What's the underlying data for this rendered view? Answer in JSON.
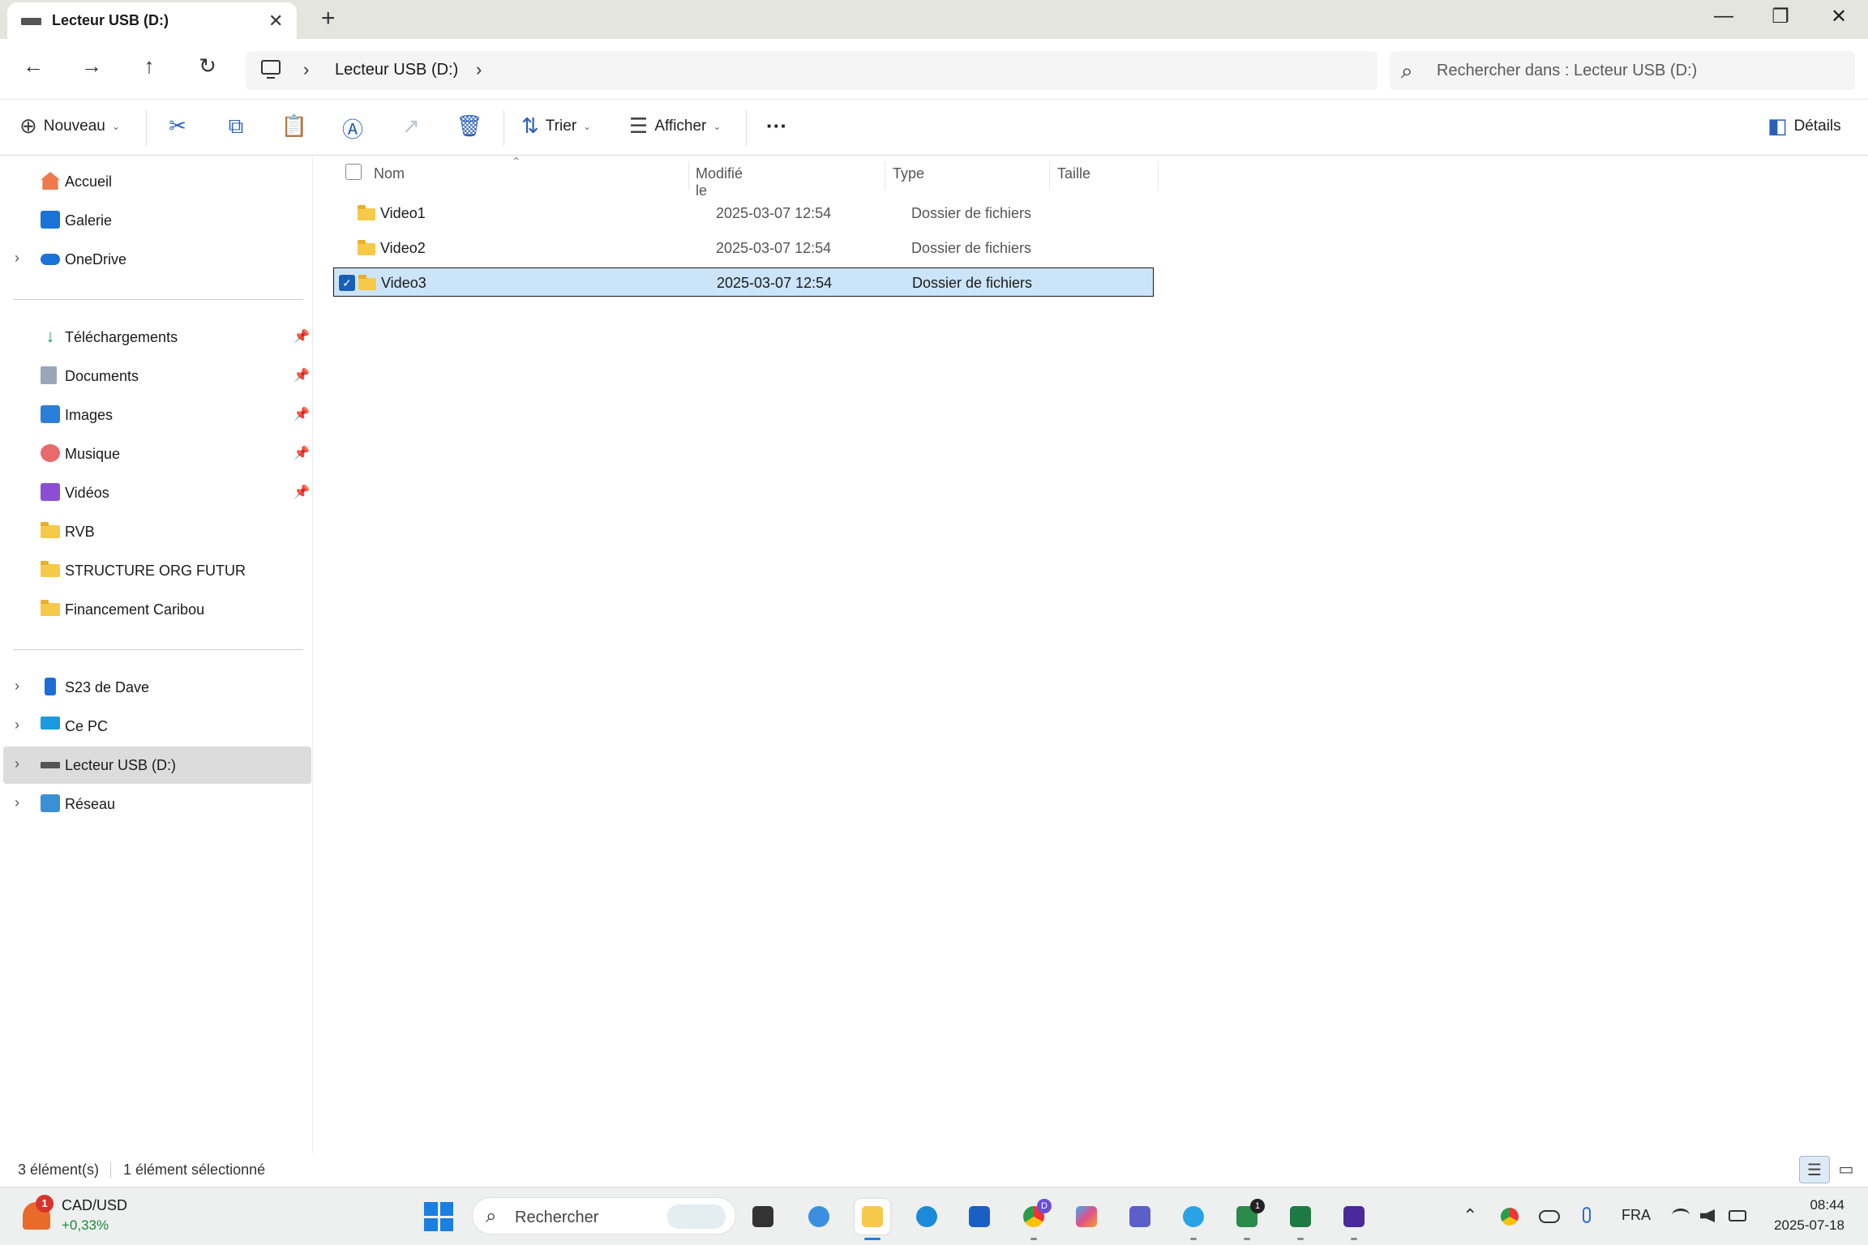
{
  "window": {
    "tab_title": "Lecteur USB (D:)",
    "close_tab_glyph": "✕",
    "new_tab_glyph": "+",
    "controls": {
      "minimize": "—",
      "maximize": "❐",
      "close": "✕"
    }
  },
  "nav": {
    "back_glyph": "←",
    "forward_glyph": "→",
    "up_glyph": "↑",
    "refresh_glyph": "↻",
    "breadcrumb_sep": "›",
    "breadcrumb_location": "Lecteur USB (D:)",
    "search_placeholder": "Rechercher dans : Lecteur USB (D:)",
    "search_glyph": "⌕"
  },
  "commands": {
    "new_label": "Nouveau",
    "new_glyph": "⊕",
    "cut_glyph": "✂",
    "copy_glyph": "⧉",
    "paste_glyph": "📋",
    "rename_glyph": "Ⓐ",
    "share_glyph": "↗",
    "delete_glyph": "🗑",
    "sort_label": "Trier",
    "sort_glyph": "⇅",
    "view_label": "Afficher",
    "view_glyph": "☰",
    "more_glyph": "···",
    "caret_glyph": "⌄",
    "details_label": "Détails",
    "details_glyph": "◧"
  },
  "sidebar": {
    "chevron_glyph": "›",
    "pin_glyph": "📌",
    "quick": [
      {
        "label": "Accueil",
        "icon": "home-icon"
      },
      {
        "label": "Galerie",
        "icon": "gallery-icon"
      },
      {
        "label": "OneDrive",
        "icon": "onedrive-icon",
        "expandable": true
      }
    ],
    "pinned": [
      {
        "label": "Téléchargements",
        "icon": "download-icon",
        "pinned": true
      },
      {
        "label": "Documents",
        "icon": "documents-icon",
        "pinned": true
      },
      {
        "label": "Images",
        "icon": "images-icon",
        "pinned": true
      },
      {
        "label": "Musique",
        "icon": "music-icon",
        "pinned": true
      },
      {
        "label": "Vidéos",
        "icon": "videos-icon",
        "pinned": true
      },
      {
        "label": "RVB",
        "icon": "folder-icon"
      },
      {
        "label": "STRUCTURE ORG FUTUR",
        "icon": "folder-icon"
      },
      {
        "label": "Financement Caribou",
        "icon": "folder-icon"
      }
    ],
    "devices": [
      {
        "label": "S23 de Dave",
        "icon": "phone-icon",
        "expandable": true
      },
      {
        "label": "Ce PC",
        "icon": "pc-icon",
        "expandable": true
      },
      {
        "label": "Lecteur USB (D:)",
        "icon": "usb-drive-icon",
        "expandable": true,
        "selected": true
      },
      {
        "label": "Réseau",
        "icon": "network-icon",
        "expandable": true
      }
    ]
  },
  "file_list": {
    "sort_caret": "⌃",
    "columns": [
      "Nom",
      "Modifié le",
      "Type",
      "Taille"
    ],
    "rows": [
      {
        "name": "Video1",
        "modified": "2025-03-07 12:54",
        "type": "Dossier de fichiers",
        "selected": false
      },
      {
        "name": "Video2",
        "modified": "2025-03-07 12:54",
        "type": "Dossier de fichiers",
        "selected": false
      },
      {
        "name": "Video3",
        "modified": "2025-03-07 12:54",
        "type": "Dossier de fichiers",
        "selected": true
      }
    ],
    "check_glyph": "✓"
  },
  "status": {
    "item_count": "3 élément(s)",
    "selection": "1 élément sélectionné",
    "details_view_glyph": "☰",
    "tiles_view_glyph": "▭"
  },
  "taskbar": {
    "weather_badge": "1",
    "ticker_name": "CAD/USD",
    "ticker_value": "+0,33%",
    "search_label": "Rechercher",
    "search_glyph": "⌕",
    "chat_badge": "1",
    "chrome_badge": "D",
    "tray_up_glyph": "⌃",
    "language": "FRA",
    "time": "08:44",
    "date": "2025-07-18",
    "colors": {
      "accent": "#1a7fe0",
      "ticker_positive": "#1a8a3a",
      "badge": "#d9342b"
    }
  }
}
